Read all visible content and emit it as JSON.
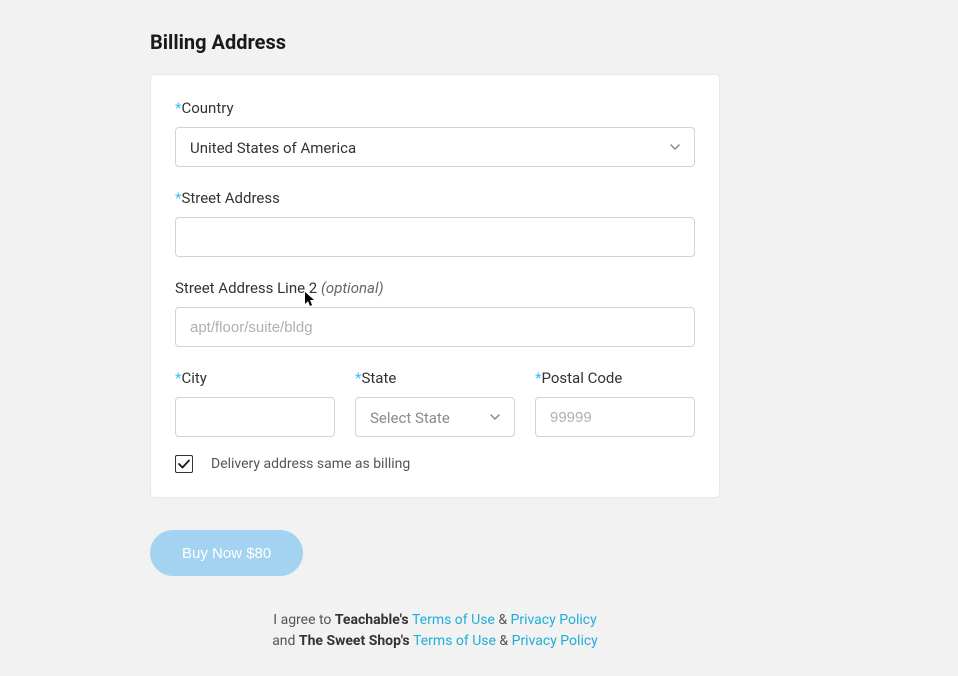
{
  "section_title": "Billing Address",
  "required_mark": "*",
  "fields": {
    "country": {
      "label": "Country",
      "value": "United States of America"
    },
    "street": {
      "label": "Street Address",
      "value": ""
    },
    "street2": {
      "label": "Street Address Line 2 ",
      "optional": "(optional)",
      "placeholder": "apt/floor/suite/bldg",
      "value": ""
    },
    "city": {
      "label": "City",
      "value": ""
    },
    "state": {
      "label": "State",
      "placeholder": "Select State"
    },
    "postal": {
      "label": "Postal Code",
      "placeholder": "99999",
      "value": ""
    }
  },
  "checkbox": {
    "label": "Delivery address same as billing",
    "checked": true
  },
  "buy_button": "Buy Now $80",
  "footer": {
    "agree": "I agree to ",
    "company1": "Teachable's ",
    "terms": "Terms of Use",
    "amp": " & ",
    "privacy": "Privacy Policy",
    "and": "and ",
    "company2": "The Sweet Shop's "
  }
}
